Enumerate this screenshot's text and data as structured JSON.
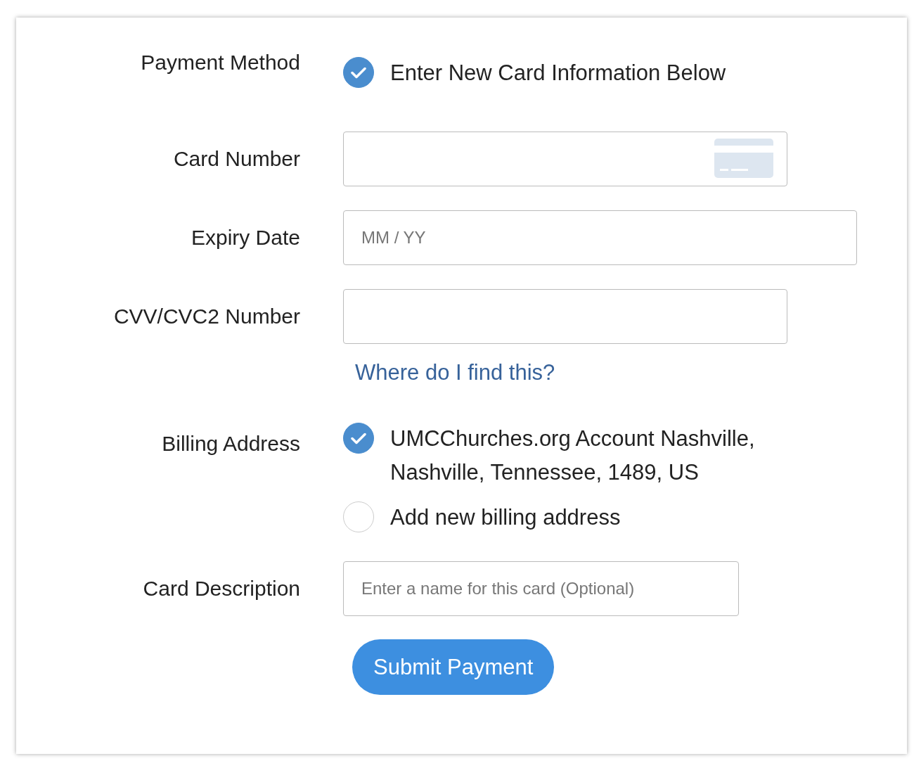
{
  "payment_method": {
    "label": "Payment Method",
    "options": [
      {
        "label": "Enter New Card Information Below",
        "selected": true
      }
    ]
  },
  "fields": [
    {
      "kind": "card",
      "label": "Card Number"
    },
    {
      "kind": "date",
      "label": "Expiry Date",
      "placeholder": "MM / YY"
    },
    {
      "kind": "code",
      "label": "CVV/CVC2 Number",
      "help_link": "Where do I find this?"
    }
  ],
  "billing_address": {
    "label": "Billing Address",
    "options": [
      {
        "label": "UMCChurches.org Account Nashville, Nashville, Tennessee, 1489, US",
        "selected": true
      },
      {
        "label": "Add new billing address",
        "selected": false
      }
    ]
  },
  "card_description": {
    "label": "Card Description",
    "placeholder": "Enter a name for this card (Optional)"
  },
  "submit_button": "Submit Payment"
}
